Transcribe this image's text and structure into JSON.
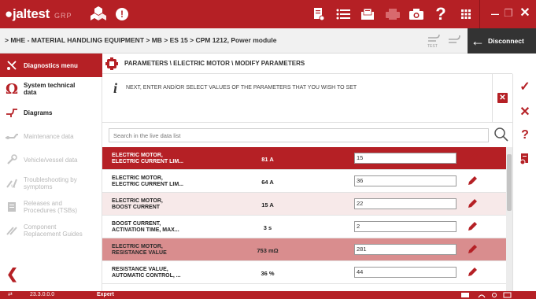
{
  "app": {
    "logo_text": "●jaltest",
    "logo_sub": "GRP",
    "alert_glyph": "!"
  },
  "breadcrumb": "> MHE - MATERIAL HANDLING EQUIPMENT  >  MB  >  ES 15  >  CPM 1212, Power module",
  "disconnect_label": "Disconnect",
  "sidebar": {
    "items": [
      {
        "label": "Diagnostics menu",
        "icon": "diagnostics-icon",
        "active": true,
        "disabled": false
      },
      {
        "label": "System technical data",
        "icon": "omega-icon",
        "active": false,
        "disabled": false
      },
      {
        "label": "Diagrams",
        "icon": "diagram-icon",
        "active": false,
        "disabled": false
      },
      {
        "label": "Maintenance data",
        "icon": "maintenance-icon",
        "active": false,
        "disabled": true
      },
      {
        "label": "Vehicle/vessel data",
        "icon": "wrench-icon",
        "active": false,
        "disabled": true
      },
      {
        "label": "Troubleshooting by symptoms",
        "icon": "troubleshoot-icon",
        "active": false,
        "disabled": true
      },
      {
        "label": "Releases and Procedures (TSBs)",
        "icon": "document-icon",
        "active": false,
        "disabled": true
      },
      {
        "label": "Component Replacement Guides",
        "icon": "tools-icon",
        "active": false,
        "disabled": true
      }
    ]
  },
  "content": {
    "title": "PARAMETERS \\ ELECTRIC MOTOR \\ MODIFY PARAMETERS",
    "instruction": "NEXT, ENTER AND/OR SELECT VALUES OF THE PARAMETERS THAT YOU WISH TO SET",
    "search_placeholder": "Search in the live data list"
  },
  "rows": [
    {
      "name1": "ELECTRIC MOTOR,",
      "name2": "ELECTRIC CURRENT LIM...",
      "value": "81 A",
      "input": "15",
      "style": "sel"
    },
    {
      "name1": "ELECTRIC MOTOR,",
      "name2": "ELECTRIC CURRENT LIM...",
      "value": "64 A",
      "input": "36",
      "style": "plain"
    },
    {
      "name1": "ELECTRIC MOTOR,",
      "name2": "BOOST CURRENT",
      "value": "15 A",
      "input": "22",
      "style": "stripe"
    },
    {
      "name1": "BOOST CURRENT,",
      "name2": "ACTIVATION TIME, MAX...",
      "value": "3 s",
      "input": "2",
      "style": "plain"
    },
    {
      "name1": "ELECTRIC MOTOR,",
      "name2": "RESISTANCE VALUE",
      "value": "753 mΩ",
      "input": "281",
      "style": "hl"
    },
    {
      "name1": "RESISTANCE VALUE,",
      "name2": "AUTOMATIC CONTROL, ...",
      "value": "36 %",
      "input": "44",
      "style": "plain"
    }
  ],
  "footer": {
    "version": "23.3.0.0.0",
    "mode": "Expert"
  },
  "colors": {
    "brand_red": "#b52025",
    "highlight_row": "#d98d8e",
    "stripe_row": "#f7e9e9"
  }
}
